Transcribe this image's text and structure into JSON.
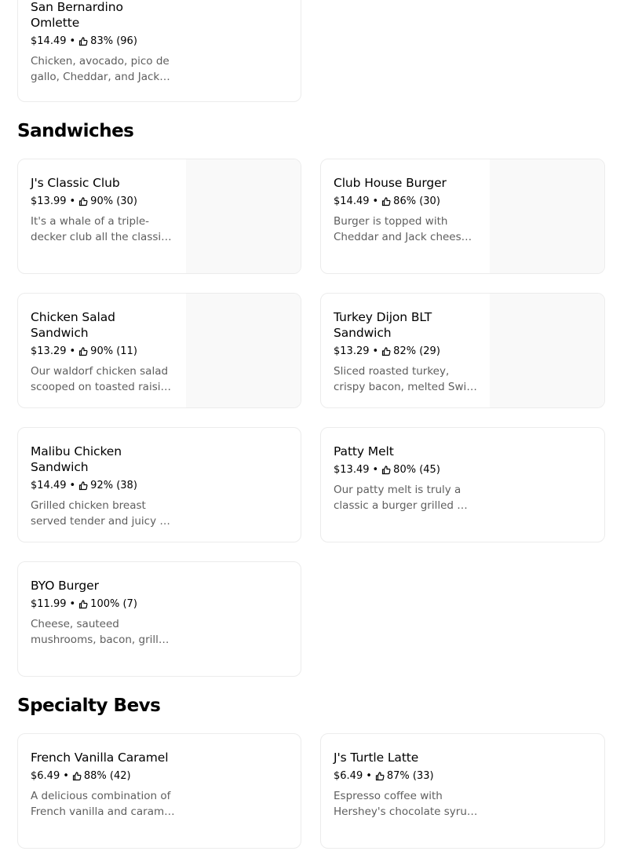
{
  "sections": {
    "sandwiches": "Sandwiches",
    "bevs": "Specialty Bevs"
  },
  "items": {
    "omlette": {
      "name": "San Bernardino Omlette",
      "price": "$14.49",
      "rating": "83% (96)",
      "desc": "Chicken, avocado, pico de gallo, Cheddar, and Jack cheese."
    },
    "classic_club": {
      "name": "J's Classic Club",
      "price": "$13.99",
      "rating": "90% (30)",
      "desc": "It's a whale of a triple-decker club all the classic fixings."
    },
    "club_burger": {
      "name": "Club House Burger",
      "price": "$14.49",
      "rating": "86% (30)",
      "desc": "Burger is topped with Cheddar and Jack cheese, bacon and more."
    },
    "chicken_salad": {
      "name": "Chicken Salad Sandwich",
      "price": "$13.29",
      "rating": "90% (11)",
      "desc": "Our waldorf chicken salad scooped on toasted raisin bread."
    },
    "turkey_dijon": {
      "name": "Turkey Dijon BLT Sandwich",
      "price": "$13.29",
      "rating": "82% (29)",
      "desc": "Sliced roasted turkey, crispy bacon, melted Swiss with dijon."
    },
    "malibu": {
      "name": "Malibu Chicken Sandwich",
      "price": "$14.49",
      "rating": "92% (38)",
      "desc": "Grilled chicken breast served tender and juicy on a bun."
    },
    "patty_melt": {
      "name": "Patty Melt",
      "price": "$13.49",
      "rating": "80% (45)",
      "desc": "Our patty melt is truly a classic a burger grilled to perfection."
    },
    "byo_burger": {
      "name": "BYO Burger",
      "price": "$11.99",
      "rating": "100% (7)",
      "desc": "Cheese, sauteed mushrooms, bacon, grilled onions and more."
    },
    "vanilla_caramel": {
      "name": "French Vanilla Caramel",
      "price": "$6.49",
      "rating": "88% (42)",
      "desc": "A delicious combination of French vanilla and caramel flavors."
    },
    "turtle_latte": {
      "name": "J's Turtle Latte",
      "price": "$6.49",
      "rating": "87% (33)",
      "desc": "Espresso coffee with Hershey's chocolate syrup, caramel and more."
    }
  },
  "icons": {
    "rating": "thumbs-up-icon"
  },
  "colors": {
    "secondary_text": "#5e5e5e",
    "image_placeholder": "#f9f9f9",
    "card_border": "#ececec"
  }
}
